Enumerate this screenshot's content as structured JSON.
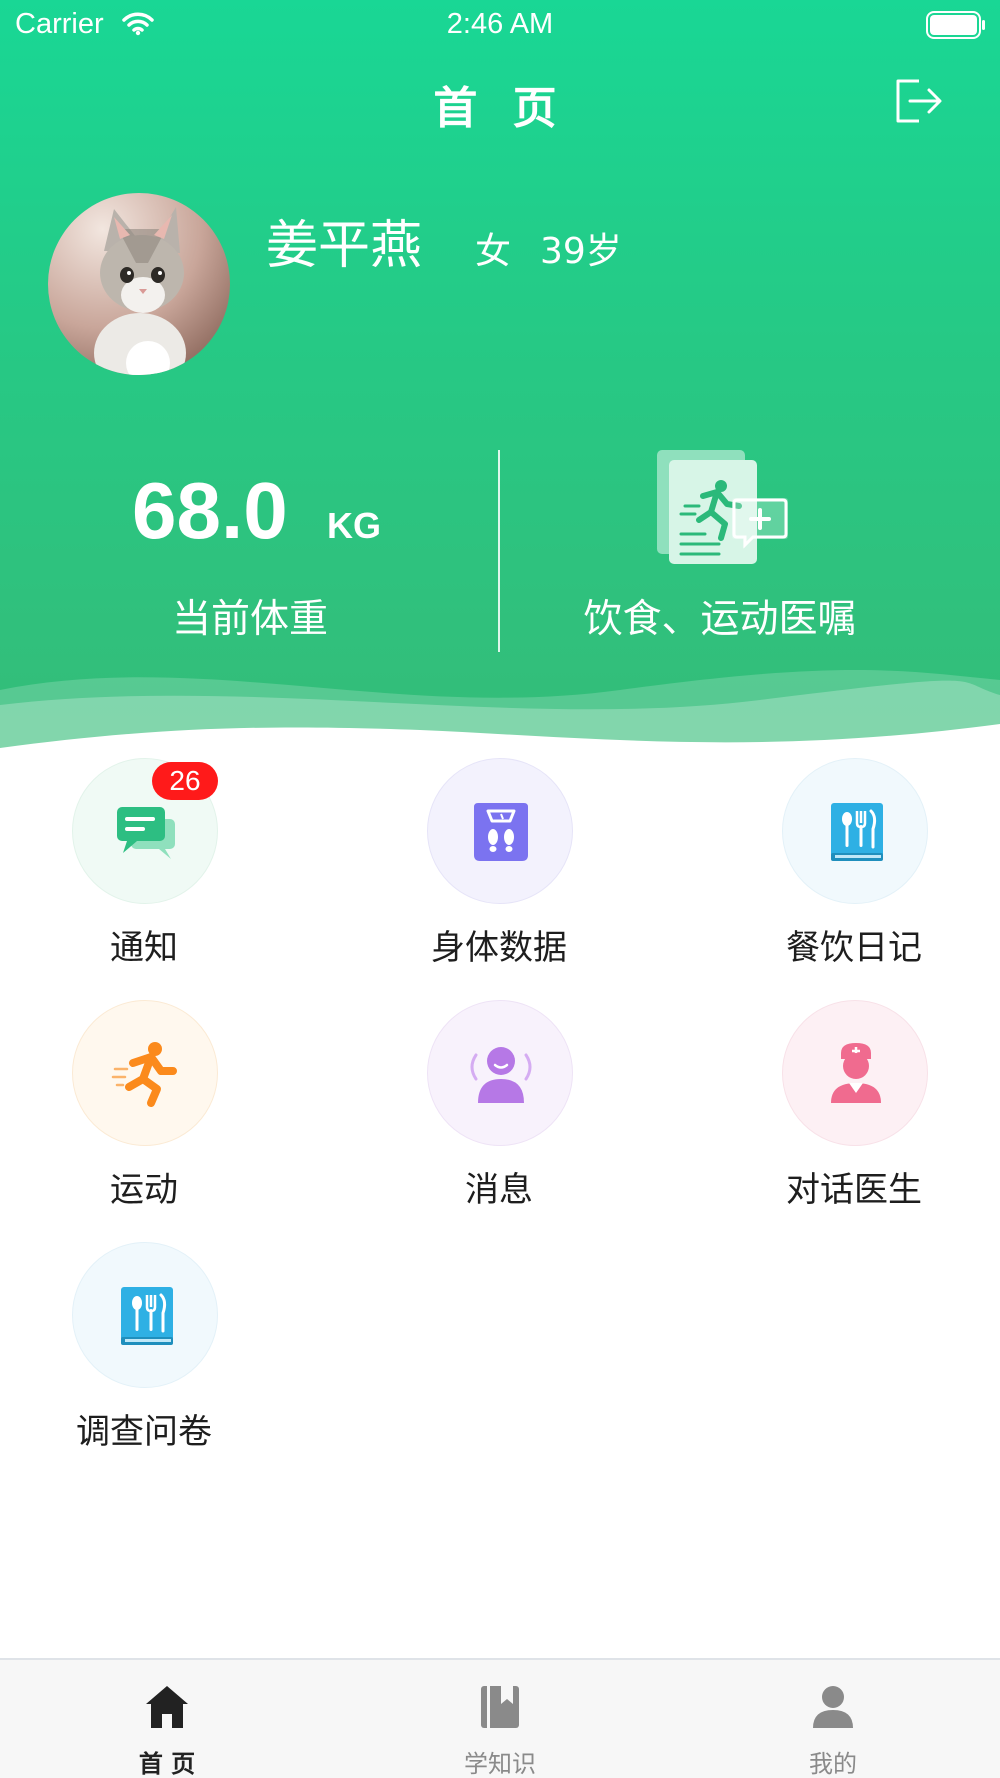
{
  "status_bar": {
    "carrier": "Carrier",
    "time": "2:46 AM"
  },
  "header": {
    "title": "首 页",
    "logout_icon": "logout-icon"
  },
  "profile": {
    "name": "姜平燕",
    "gender": "女",
    "age": "39岁"
  },
  "stats": {
    "weight_value": "68.0",
    "weight_unit": "KG",
    "weight_label": "当前体重",
    "advice_label": "饮食、运动医嘱"
  },
  "grid": [
    {
      "label": "通知",
      "icon": "chat-bubbles-icon",
      "badge": "26",
      "color": "#2dbe82",
      "bg": "#eefaf4"
    },
    {
      "label": "身体数据",
      "icon": "scale-icon",
      "color": "#7b73f0",
      "bg": "#f1f0fd"
    },
    {
      "label": "餐饮日记",
      "icon": "diet-book-icon",
      "color": "#2eb0e4",
      "bg": "#eff8fd"
    },
    {
      "label": "运动",
      "icon": "running-icon",
      "color": "#fb8a1c",
      "bg": "#fff6ea"
    },
    {
      "label": "消息",
      "icon": "message-person-icon",
      "color": "#b678e6",
      "bg": "#f7f0fc"
    },
    {
      "label": "对话医生",
      "icon": "nurse-icon",
      "color": "#f06b8f",
      "bg": "#fdeff3"
    },
    {
      "label": "调查问卷",
      "icon": "questionnaire-book-icon",
      "color": "#2eb0e4",
      "bg": "#eff8fd"
    }
  ],
  "tab_bar": {
    "items": [
      {
        "label": "首 页",
        "icon": "home-icon",
        "active": true
      },
      {
        "label": "学知识",
        "icon": "book-icon",
        "active": false
      },
      {
        "label": "我的",
        "icon": "person-icon",
        "active": false
      }
    ],
    "active_color": "#222222",
    "inactive_color": "#8a8a8a"
  }
}
